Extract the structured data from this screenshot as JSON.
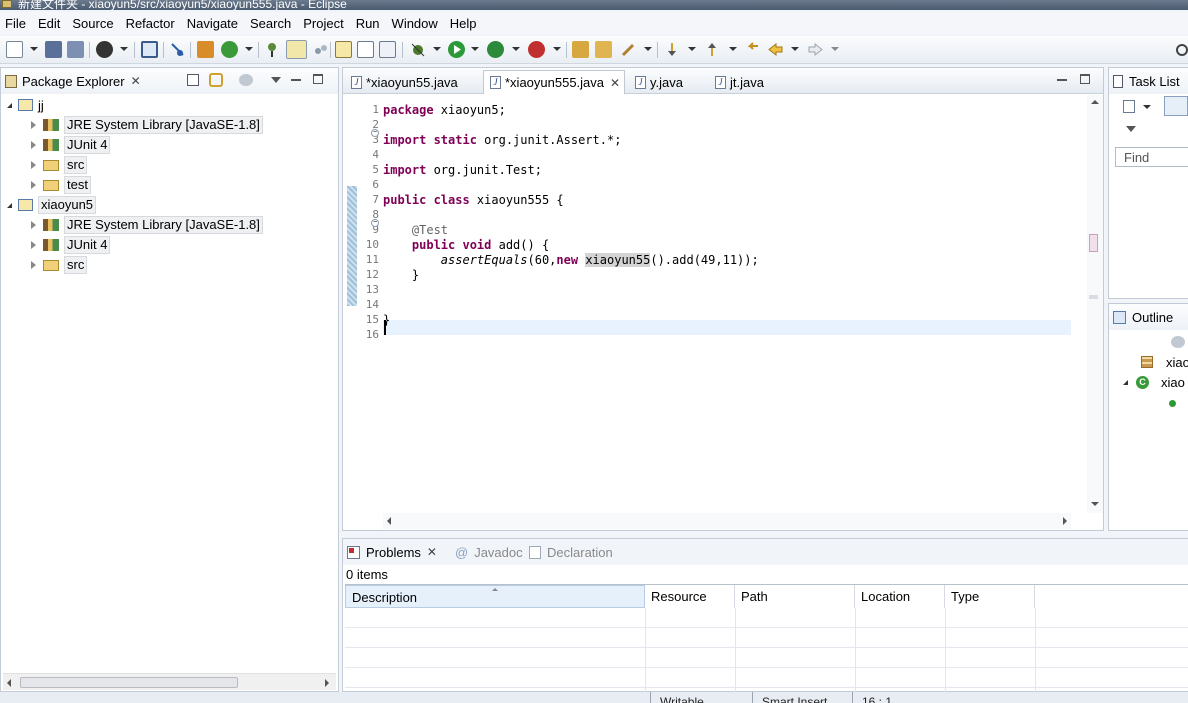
{
  "window": {
    "title": "新建文件夹 - xiaoyun5/src/xiaoyun5/xiaoyun555.java - Eclipse"
  },
  "menu": [
    "File",
    "Edit",
    "Source",
    "Refactor",
    "Navigate",
    "Search",
    "Project",
    "Run",
    "Window",
    "Help"
  ],
  "package_explorer": {
    "title": "Package Explorer",
    "tree": [
      {
        "label": "jj",
        "level": 0,
        "expanded": true,
        "icon": "project-icon"
      },
      {
        "label": "JRE System Library [JavaSE-1.8]",
        "level": 1,
        "expanded": false,
        "icon": "library-icon"
      },
      {
        "label": "JUnit 4",
        "level": 1,
        "expanded": false,
        "icon": "library-icon"
      },
      {
        "label": "src",
        "level": 1,
        "expanded": false,
        "icon": "source-folder-icon"
      },
      {
        "label": "test",
        "level": 1,
        "expanded": false,
        "icon": "source-folder-icon"
      },
      {
        "label": "xiaoyun5",
        "level": 0,
        "expanded": true,
        "icon": "project-icon"
      },
      {
        "label": "JRE System Library [JavaSE-1.8]",
        "level": 1,
        "expanded": false,
        "icon": "library-icon"
      },
      {
        "label": "JUnit 4",
        "level": 1,
        "expanded": false,
        "icon": "library-icon"
      },
      {
        "label": "src",
        "level": 1,
        "expanded": false,
        "icon": "source-folder-icon"
      }
    ]
  },
  "editor": {
    "tabs": [
      {
        "label": "*xiaoyun55.java",
        "active": false
      },
      {
        "label": "*xiaoyun555.java",
        "active": true
      },
      {
        "label": "y.java",
        "active": false
      },
      {
        "label": "jt.java",
        "active": false
      }
    ],
    "line_numbers": [
      "1",
      "2",
      "3",
      "4",
      "5",
      "6",
      "7",
      "8",
      "9",
      "10",
      "11",
      "12",
      "13",
      "14",
      "15",
      "16"
    ],
    "code": {
      "l1_kw": "package",
      "l1_rest": " xiaoyun5;",
      "l3_kw": "import static",
      "l3_rest": " org.junit.Assert.*;",
      "l5_kw": "import",
      "l5_rest": " org.junit.Test;",
      "l7_kw": "public class",
      "l7_rest": " xiaoyun555 {",
      "l9_ann": "    @Test",
      "l10_kw": "    public void",
      "l10_rest": " add() {",
      "l11_pre": "        ",
      "l11_call": "assertEquals",
      "l11_mid": "(60,",
      "l11_kw": "new",
      "l11_sp": " ",
      "l11_hl": "xiaoyun55",
      "l11_end": "().add(49,11));",
      "l12": "    }",
      "l15": "}"
    }
  },
  "task_list": {
    "title": "Task List",
    "find_placeholder": "Find"
  },
  "outline": {
    "title": "Outline",
    "items": [
      "xiao",
      "xiao"
    ]
  },
  "bottom": {
    "tabs": [
      {
        "label": "Problems",
        "active": true
      },
      {
        "label": "Javadoc",
        "active": false
      },
      {
        "label": "Declaration",
        "active": false
      }
    ],
    "summary": "0 items",
    "columns": [
      "Description",
      "Resource",
      "Path",
      "Location",
      "Type"
    ]
  },
  "status": {
    "writable": "Writable",
    "insert_mode": "Smart Insert",
    "position": "16 : 1"
  },
  "colors": {
    "keyword": "#7f0055",
    "annotation": "#646464",
    "linenumber": "#787878"
  }
}
